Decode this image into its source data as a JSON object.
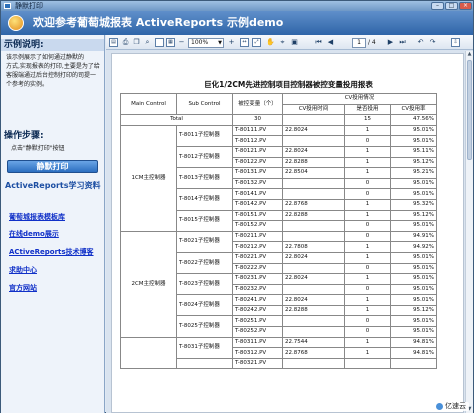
{
  "window": {
    "title": "静默打印"
  },
  "header": {
    "title": "欢迎参考葡萄城报表 ActiveReports 示例demo"
  },
  "sidebar": {
    "description_heading": "示例说明:",
    "description_lines": [
      "该示例展示了如何通过静默的",
      "方式,实现报表的打印,主要是为了给",
      "客服端通过后台控制打印的司提一",
      "个参考的实例。"
    ],
    "steps_heading": "操作步骤:",
    "step_text": "点击\"静默打印\"按钮",
    "print_button": "静默打印",
    "resources_heading": "ActiveReports学习资料",
    "links": [
      "葡萄城报表模板库",
      "在线demo展示",
      "ACtiveReports技术博客",
      "求助中心",
      "官方网站"
    ]
  },
  "toolbar": {
    "zoom": "100%",
    "page_current": "1",
    "page_total": "/ 4",
    "icons": [
      "sidebar-toggle-icon",
      "print-icon",
      "copy-icon",
      "find-icon",
      "single-page-icon",
      "multi-page-icon",
      "zoom-out-icon",
      "zoom-in-icon",
      "first-page-icon",
      "prev-page-icon",
      "next-page-icon",
      "last-page-icon",
      "back-icon",
      "forward-icon",
      "export-icon"
    ]
  },
  "report": {
    "title": "巨化1/2CM先进控制项目控制器被控变量投用报表",
    "headers": {
      "main_control": "Main Control",
      "sub_control": "Sub Control",
      "variable": "被控变量（个）",
      "cv_group": "CV投用情况",
      "cv_time": "CV投用时间",
      "cv_used": "是否投用",
      "cv_rate": "CV投用率"
    },
    "total": {
      "label": "Total",
      "count": "30",
      "used": "15",
      "rate": "47.56%"
    },
    "groups": [
      {
        "main": "1CM主控制器",
        "subs": [
          {
            "name": "T-8011子控制器",
            "rows": [
              {
                "pv": "T-80111.PV",
                "time": "22.8024",
                "used": "1",
                "rate": "95.01%"
              },
              {
                "pv": "T-80112.PV",
                "time": "",
                "used": "0",
                "rate": "95.01%"
              }
            ]
          },
          {
            "name": "T-8012子控制器",
            "rows": [
              {
                "pv": "T-80121.PV",
                "time": "22.8024",
                "used": "1",
                "rate": "95.11%"
              },
              {
                "pv": "T-80122.PV",
                "time": "22.8288",
                "used": "1",
                "rate": "95.12%"
              }
            ]
          },
          {
            "name": "T-8013子控制器",
            "rows": [
              {
                "pv": "T-80131.PV",
                "time": "22.8504",
                "used": "1",
                "rate": "95.21%"
              },
              {
                "pv": "T-80132.PV",
                "time": "",
                "used": "0",
                "rate": "95.01%"
              }
            ]
          },
          {
            "name": "T-8014子控制器",
            "rows": [
              {
                "pv": "T-80141.PV",
                "time": "",
                "used": "0",
                "rate": "95.01%"
              },
              {
                "pv": "T-80142.PV",
                "time": "22.8768",
                "used": "1",
                "rate": "95.32%"
              }
            ]
          },
          {
            "name": "T-8015子控制器",
            "rows": [
              {
                "pv": "T-80151.PV",
                "time": "22.8288",
                "used": "1",
                "rate": "95.12%"
              },
              {
                "pv": "T-80152.PV",
                "time": "",
                "used": "0",
                "rate": "95.01%"
              }
            ]
          }
        ]
      },
      {
        "main": "2CM主控制器",
        "subs": [
          {
            "name": "T-8021子控制器",
            "rows": [
              {
                "pv": "T-80211.PV",
                "time": "",
                "used": "0",
                "rate": "94.91%"
              },
              {
                "pv": "T-80212.PV",
                "time": "22.7808",
                "used": "1",
                "rate": "94.92%"
              }
            ]
          },
          {
            "name": "T-8022子控制器",
            "rows": [
              {
                "pv": "T-80221.PV",
                "time": "22.8024",
                "used": "1",
                "rate": "95.01%"
              },
              {
                "pv": "T-80222.PV",
                "time": "",
                "used": "0",
                "rate": "95.01%"
              }
            ]
          },
          {
            "name": "T-8023子控制器",
            "rows": [
              {
                "pv": "T-80231.PV",
                "time": "22.8024",
                "used": "1",
                "rate": "95.01%"
              },
              {
                "pv": "T-80232.PV",
                "time": "",
                "used": "0",
                "rate": "95.01%"
              }
            ]
          },
          {
            "name": "T-8024子控制器",
            "rows": [
              {
                "pv": "T-80241.PV",
                "time": "22.8024",
                "used": "1",
                "rate": "95.01%"
              },
              {
                "pv": "T-80242.PV",
                "time": "22.8288",
                "used": "1",
                "rate": "95.12%"
              }
            ]
          },
          {
            "name": "T-8025子控制器",
            "rows": [
              {
                "pv": "T-80251.PV",
                "time": "",
                "used": "0",
                "rate": "95.01%"
              },
              {
                "pv": "T-80252.PV",
                "time": "",
                "used": "0",
                "rate": "95.01%"
              }
            ]
          }
        ]
      },
      {
        "main": "",
        "subs": [
          {
            "name": "T-8031子控制器",
            "rows": [
              {
                "pv": "T-80311.PV",
                "time": "22.7544",
                "used": "1",
                "rate": "94.81%"
              },
              {
                "pv": "T-80312.PV",
                "time": "22.8768",
                "used": "1",
                "rate": "94.81%"
              }
            ]
          },
          {
            "name": "",
            "rows": [
              {
                "pv": "T-80321.PV",
                "time": "",
                "used": "",
                "rate": ""
              }
            ]
          }
        ]
      }
    ]
  },
  "watermark": {
    "text": "亿速云"
  }
}
